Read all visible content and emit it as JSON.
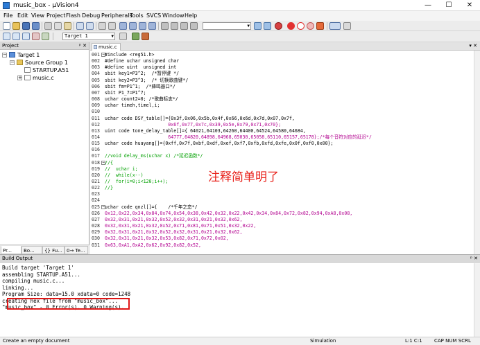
{
  "window": {
    "title": "music_box - µVision4",
    "min_glyph": "—",
    "max_glyph": "☐",
    "close_glyph": "✕"
  },
  "menu": [
    "File",
    "Edit",
    "View",
    "Project",
    "Flash",
    "Debug",
    "Peripherals",
    "Tools",
    "SVCS",
    "Window",
    "Help"
  ],
  "toolbar": {
    "find_combo_value": "",
    "target_combo_value": "Target 1"
  },
  "project_panel": {
    "title": "Project",
    "pin_glyph": "ᵖ ✕",
    "tree": {
      "target": "Target 1",
      "group": "Source Group 1",
      "files": [
        "STARTUP.A51",
        "music.c"
      ]
    },
    "tabs": [
      "Pr...",
      "Bo...",
      "{} Fu...",
      "0→ Te..."
    ]
  },
  "editor": {
    "tab_label": "music.c",
    "lines": [
      {
        "n": "001",
        "t": "#include <reg51.h>",
        "s": "code"
      },
      {
        "n": "002",
        "t": "#define uchar unsigned char",
        "s": "code"
      },
      {
        "n": "003",
        "t": "#define uint  unsigned int",
        "s": "code"
      },
      {
        "n": "004",
        "t": "sbit key1=P3^2;  /*暂停键 */",
        "s": "code"
      },
      {
        "n": "005",
        "t": "sbit key2=P3^3;  /* 切换歌曲键*/",
        "s": "code"
      },
      {
        "n": "006",
        "t": "sbit fm=P1^1;  /*蜂鸣器口*/",
        "s": "code"
      },
      {
        "n": "007",
        "t": "sbit P1_7=P1^7;",
        "s": "code"
      },
      {
        "n": "008",
        "t": "uchar count2=0; /*歌曲标志*/",
        "s": "code"
      },
      {
        "n": "009",
        "t": "uchar timeh,timel,i;",
        "s": "code"
      },
      {
        "n": "010",
        "t": "",
        "s": "code"
      },
      {
        "n": "011",
        "t": "uchar code DSY_table[]={0x3f,0x06,0x5b,0x4f,0x66,0x6d,0x7d,0x07,0x7f,",
        "s": "code"
      },
      {
        "n": "012",
        "t": "                       0x6f,0x77,0x7c,0x39,0x5e,0x79,0x71,0x70};",
        "s": "data"
      },
      {
        "n": "013",
        "t": "uint code tone_delay_table[]={ 64021,64103,64260,64400,64524,64580,64684,",
        "s": "code"
      },
      {
        "n": "014",
        "t": "                       64777,64820,64898,64968,65030,65058,65110,65157,65178};/*每个音符对应的延迟*/",
        "s": "data"
      },
      {
        "n": "015",
        "t": "uchar code huayang[]={0xff,0x7f,0xbf,0xdf,0xef,0xf7,0xfb,0xfd,0xfe,0x0f,0xf0,0x00};",
        "s": "code"
      },
      {
        "n": "016",
        "t": "",
        "s": "code"
      },
      {
        "n": "017",
        "t": "//void delay_ms(uchar x) /*延迟函数*/",
        "s": "comment"
      },
      {
        "n": "018",
        "t": "//{",
        "s": "comment"
      },
      {
        "n": "019",
        "t": "//  uchar i;",
        "s": "comment"
      },
      {
        "n": "020",
        "t": "//  while(x--)",
        "s": "comment"
      },
      {
        "n": "021",
        "t": "//  for(i=0;i<120;i++);",
        "s": "comment"
      },
      {
        "n": "022",
        "t": "//}",
        "s": "comment"
      },
      {
        "n": "023",
        "t": "",
        "s": "code"
      },
      {
        "n": "024",
        "t": "",
        "s": "code"
      },
      {
        "n": "025",
        "t": "uchar code qnzl[]={    /*千年之恋*/",
        "s": "code"
      },
      {
        "n": "026",
        "t": "0x12,0x22,0x34,0x84,0x74,0x54,0x38,0x42,0x32,0x22,0x42,0x34,0x84,0x72,0x82,0x94,0xA8,0x08,",
        "s": "data"
      },
      {
        "n": "027",
        "t": "0x32,0x31,0x21,0x32,0x52,0x32,0x31,0x21,0x32,0x62,",
        "s": "data"
      },
      {
        "n": "028",
        "t": "0x32,0x31,0x21,0x32,0x52,0x71,0x81,0x71,0x51,0x32,0x22,",
        "s": "data"
      },
      {
        "n": "029",
        "t": "0x32,0x31,0x21,0x32,0x52,0x32,0x31,0x21,0x32,0x62,",
        "s": "data"
      },
      {
        "n": "030",
        "t": "0x32,0x31,0x21,0x32,0x53,0x82,0x71,0x72,0x02,",
        "s": "data"
      },
      {
        "n": "031",
        "t": "0x63,0xA1,0xA2,0x62,0x92,0x82,0x52,",
        "s": "data"
      }
    ],
    "overlay_note": "注释简单明了"
  },
  "build_output": {
    "title": "Build Output",
    "lines": [
      "Build target 'Target 1'",
      "assembling STARTUP.A51...",
      "compiling music.c...",
      "linking...",
      "Program Size: data=15.0 xdata=0 code=1248",
      "creating hex file from \"music_box\"...",
      "\"music_box\" - 0 Error(s), 0 Warning(s)."
    ]
  },
  "status": {
    "message": "Create an empty document",
    "mode": "Simulation",
    "position": "L:1 C:1",
    "keys": "CAP NUM SCRL OVR R /W"
  },
  "colors": {
    "accent_highlight": "#e01515",
    "comment": "#00a000",
    "data_literal": "#b2008f"
  }
}
